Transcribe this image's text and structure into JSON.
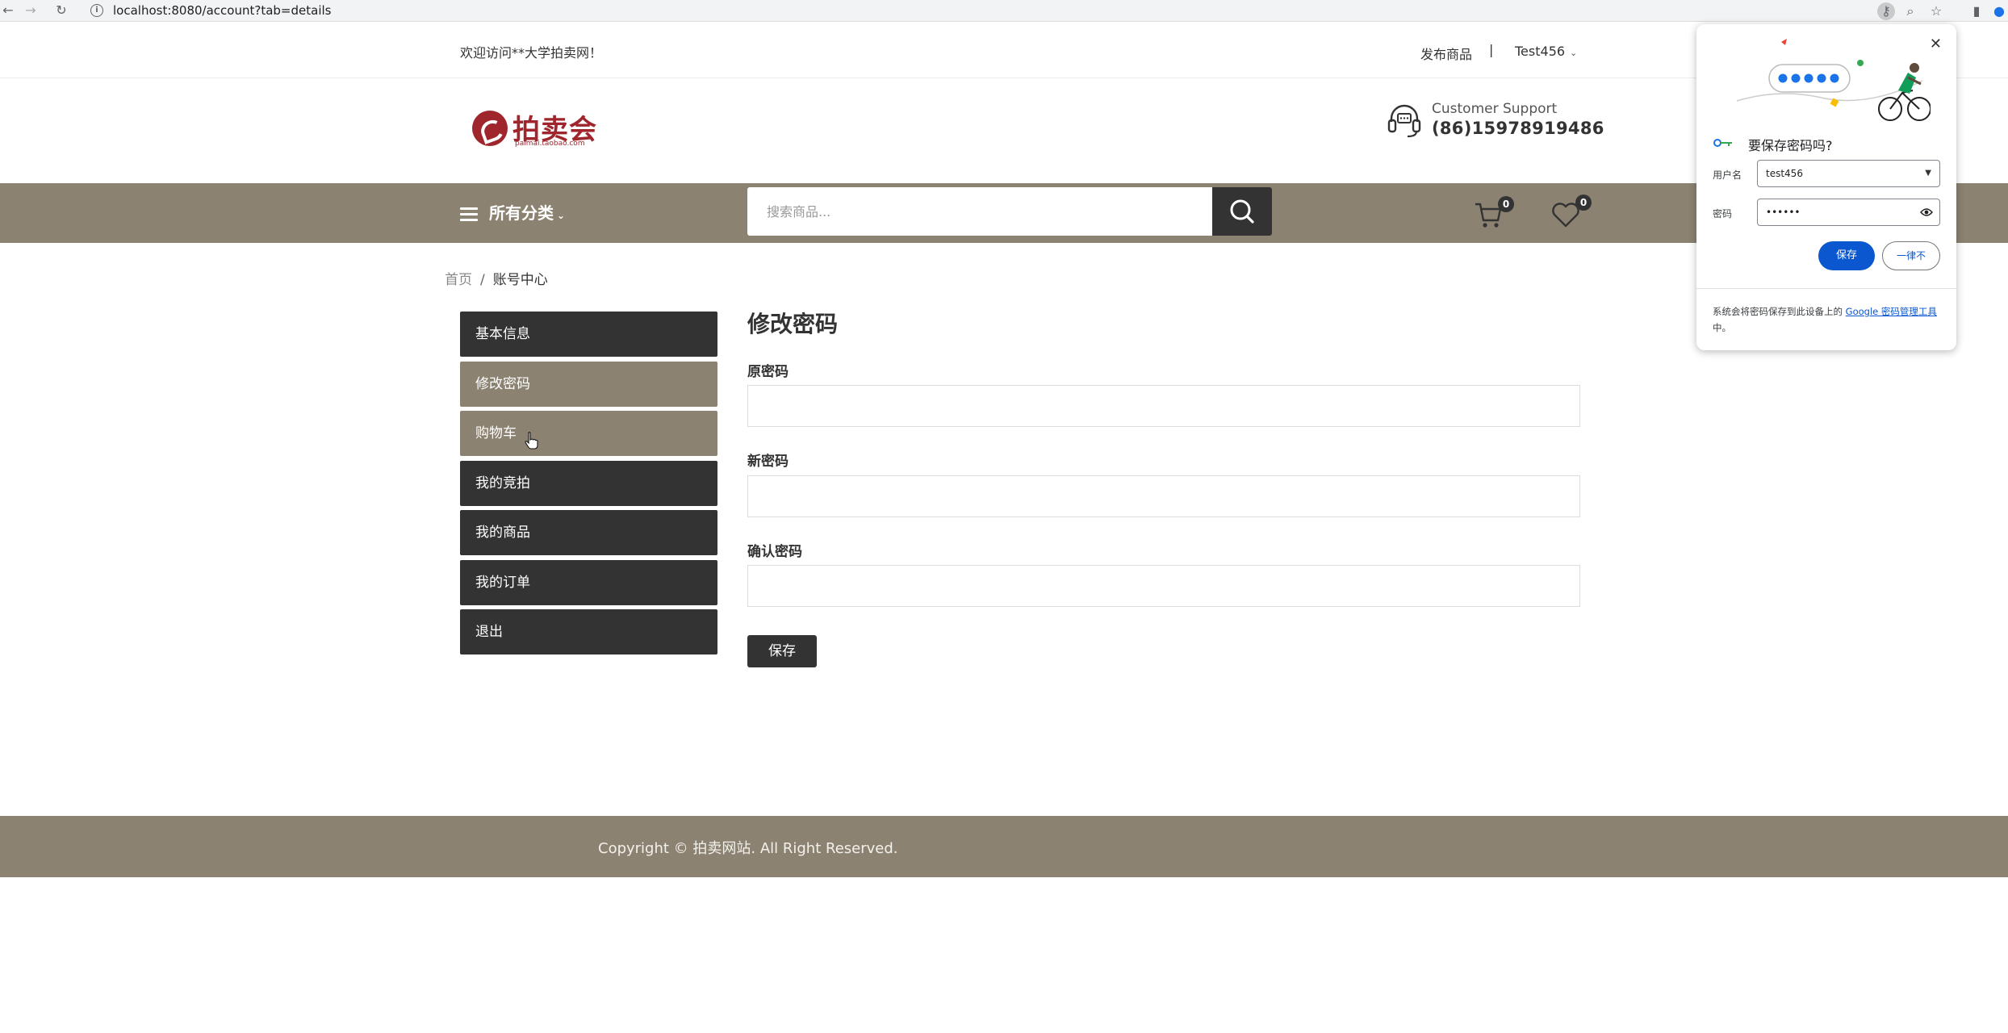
{
  "browser": {
    "url": "localhost:8080/account?tab=details"
  },
  "topbar": {
    "welcome": "欢迎访问**大学拍卖网！",
    "publish": "发布商品",
    "separator": "|",
    "user": "Test456"
  },
  "header": {
    "logo_text": "拍卖会",
    "logo_domain": "paimai.taobao.com",
    "support_label": "Customer Support",
    "support_phone": "(86)15978919486"
  },
  "nav": {
    "categories": "所有分类",
    "search_placeholder": "搜索商品...",
    "cart_count": "0",
    "wishlist_count": "0"
  },
  "breadcrumb": {
    "home": "首页",
    "separator": "/",
    "current": "账号中心"
  },
  "sidebar": {
    "items": [
      {
        "label": "基本信息",
        "active": false
      },
      {
        "label": "修改密码",
        "active": true
      },
      {
        "label": "购物车",
        "active": true
      },
      {
        "label": "我的竞拍",
        "active": false
      },
      {
        "label": "我的商品",
        "active": false
      },
      {
        "label": "我的订单",
        "active": false
      },
      {
        "label": "退出",
        "active": false
      }
    ]
  },
  "form": {
    "title": "修改密码",
    "old_password_label": "原密码",
    "new_password_label": "新密码",
    "confirm_password_label": "确认密码",
    "save_label": "保存"
  },
  "footer": {
    "copyright": "Copyright © 拍卖网站. All Right Reserved."
  },
  "password_popup": {
    "title": "要保存密码吗?",
    "username_label": "用户名",
    "username_value": "test456",
    "password_label": "密码",
    "password_value": "••••••",
    "save_label": "保存",
    "never_label": "一律不",
    "footer_text": "系统会将密码保存到此设备上的 ",
    "footer_link": "Google 密码管理工具",
    "footer_end": "中。"
  },
  "colors": {
    "nav_bg": "#8c8271",
    "dark": "#333333",
    "brand_red": "#a0262e",
    "google_blue": "#0b57d0"
  }
}
